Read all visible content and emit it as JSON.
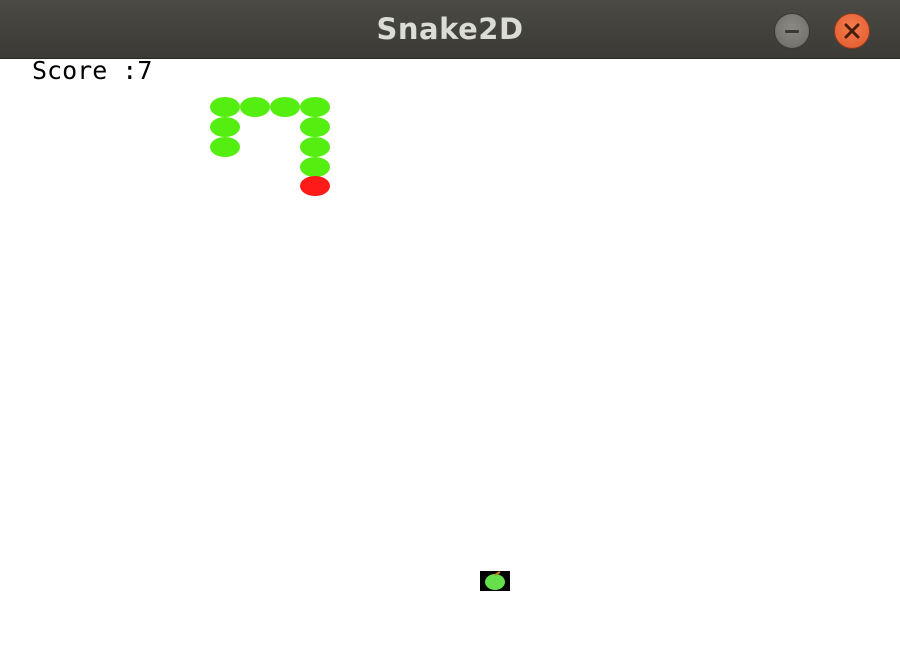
{
  "window": {
    "title": "Snake2D",
    "minimize_icon": "minimize-icon",
    "close_icon": "close-icon"
  },
  "game": {
    "score_label": "Score :",
    "score_value": "7",
    "colors": {
      "snake_body": "#55ee11",
      "snake_head": "#ff1a1a",
      "food": "#66e04a",
      "background": "#ffffff"
    },
    "snake_length": 10,
    "food_icon": "apple-icon"
  }
}
